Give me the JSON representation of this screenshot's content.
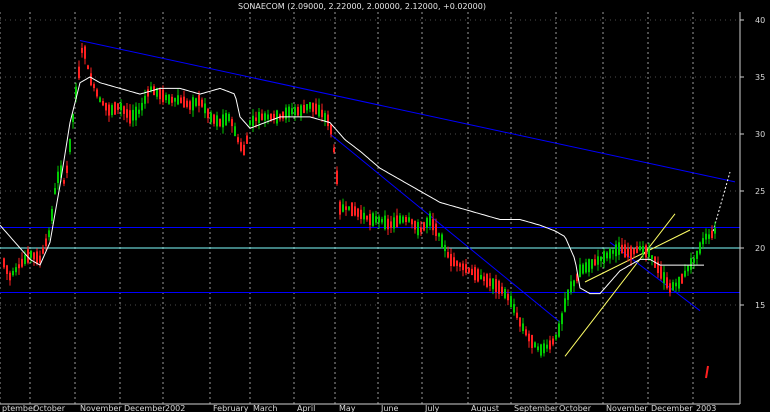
{
  "chart_data": {
    "type": "candlestick",
    "title": "SONAECOM (2.09000, 2.22000, 2.00000, 2.12000, +0.02000)",
    "xlabel": "",
    "ylabel": "",
    "ylim": [
      10,
      42
    ],
    "y_ticks": [
      15,
      20,
      25,
      30,
      35,
      40
    ],
    "x_labels": [
      "ptember",
      "October",
      "November",
      "December",
      "2002",
      "February",
      "March",
      "April",
      "May",
      "June",
      "July",
      "August",
      "September",
      "October",
      "November",
      "December",
      "2003"
    ],
    "grid": true,
    "colors": {
      "background": "#000000",
      "up": "#00cc00",
      "down": "#ff2020",
      "moving_average": "#ffffff",
      "trendline": "#0000ff",
      "support": "#0000ff",
      "level_line": "#80ffff",
      "channel": "#ffff66",
      "grid": "#9a9a9a",
      "axis_text": "#d8d8d8"
    },
    "series": [
      {
        "role": "price",
        "x": [
          0,
          10,
          20,
          30,
          40,
          50,
          55,
          60,
          65,
          70,
          75,
          80,
          83,
          90,
          100,
          110,
          120,
          130,
          140,
          150,
          160,
          170,
          180,
          190,
          200,
          210,
          220,
          230,
          240,
          245,
          250,
          260,
          270,
          280,
          290,
          300,
          310,
          320,
          330,
          335,
          340,
          350,
          360,
          370,
          380,
          390,
          400,
          410,
          420,
          430,
          440,
          450,
          460,
          470,
          480,
          490,
          500,
          510,
          520,
          530,
          540,
          550,
          555,
          560,
          565,
          570,
          575,
          580,
          590,
          600,
          610,
          620,
          630,
          640,
          650,
          660,
          670,
          680,
          690,
          695,
          700,
          705,
          710,
          715
        ],
        "values": [
          19.5,
          17.5,
          18.5,
          19.5,
          19.0,
          21.5,
          25.0,
          27.0,
          25.5,
          29.0,
          33.0,
          36.0,
          38.0,
          35.0,
          33.0,
          32.0,
          32.5,
          31.5,
          32.0,
          34.0,
          33.5,
          33.0,
          33.0,
          32.5,
          33.0,
          31.5,
          31.0,
          31.5,
          29.0,
          28.5,
          31.0,
          31.5,
          31.5,
          31.5,
          32.0,
          32.0,
          32.5,
          32.0,
          31.0,
          28.0,
          23.5,
          23.5,
          23.0,
          22.5,
          22.5,
          22.0,
          22.5,
          22.5,
          21.5,
          22.5,
          21.0,
          19.0,
          18.5,
          18.0,
          17.5,
          17.0,
          16.5,
          15.5,
          13.5,
          12.0,
          11.0,
          11.5,
          12.0,
          13.0,
          15.0,
          16.5,
          17.0,
          18.0,
          18.5,
          19.0,
          19.5,
          20.0,
          19.5,
          20.0,
          19.5,
          18.0,
          16.5,
          17.0,
          18.5,
          19.0,
          20.0,
          21.0,
          21.0,
          21.5
        ]
      },
      {
        "role": "moving_average",
        "x": [
          0,
          10,
          20,
          30,
          40,
          50,
          60,
          70,
          80,
          90,
          100,
          120,
          140,
          160,
          180,
          200,
          220,
          235,
          240,
          250,
          280,
          310,
          330,
          345,
          360,
          380,
          400,
          420,
          440,
          460,
          480,
          500,
          520,
          540,
          555,
          565,
          575,
          580,
          590,
          600,
          610,
          620,
          630,
          640,
          650,
          660,
          680,
          690,
          700,
          705
        ],
        "values": [
          22.0,
          21.0,
          20.0,
          19.0,
          18.5,
          20.5,
          25.5,
          31.0,
          34.5,
          35.0,
          34.5,
          34.0,
          33.5,
          34.0,
          34.0,
          33.5,
          34.0,
          33.5,
          31.5,
          30.5,
          31.5,
          31.5,
          31.0,
          29.5,
          28.5,
          27.0,
          26.0,
          25.0,
          24.0,
          23.5,
          23.0,
          22.5,
          22.5,
          22.0,
          21.5,
          21.0,
          19.0,
          16.5,
          16.0,
          16.0,
          17.0,
          18.0,
          18.5,
          19.0,
          19.0,
          18.5,
          18.5,
          18.5,
          18.5,
          18.5
        ]
      }
    ],
    "trendlines": [
      {
        "name": "resistance",
        "x": [
          80,
          735
        ],
        "y": [
          38.2,
          25.8
        ]
      },
      {
        "name": "support",
        "x": [
          0,
          740
        ],
        "y": [
          16.1,
          16.1
        ]
      },
      {
        "name": "resistance-break",
        "x": [
          0,
          740
        ],
        "y": [
          21.8,
          21.8
        ]
      },
      {
        "name": "level",
        "x": [
          0,
          740
        ],
        "y": [
          20.0,
          20.0
        ]
      },
      {
        "name": "decline",
        "x": [
          330,
          560
        ],
        "y": [
          30.0,
          13.5
        ]
      },
      {
        "name": "uptrend",
        "x": [
          565,
          675
        ],
        "y": [
          10.5,
          23.0
        ]
      },
      {
        "name": "late-decline",
        "x": [
          610,
          700
        ],
        "y": [
          20.5,
          14.5
        ]
      }
    ]
  }
}
